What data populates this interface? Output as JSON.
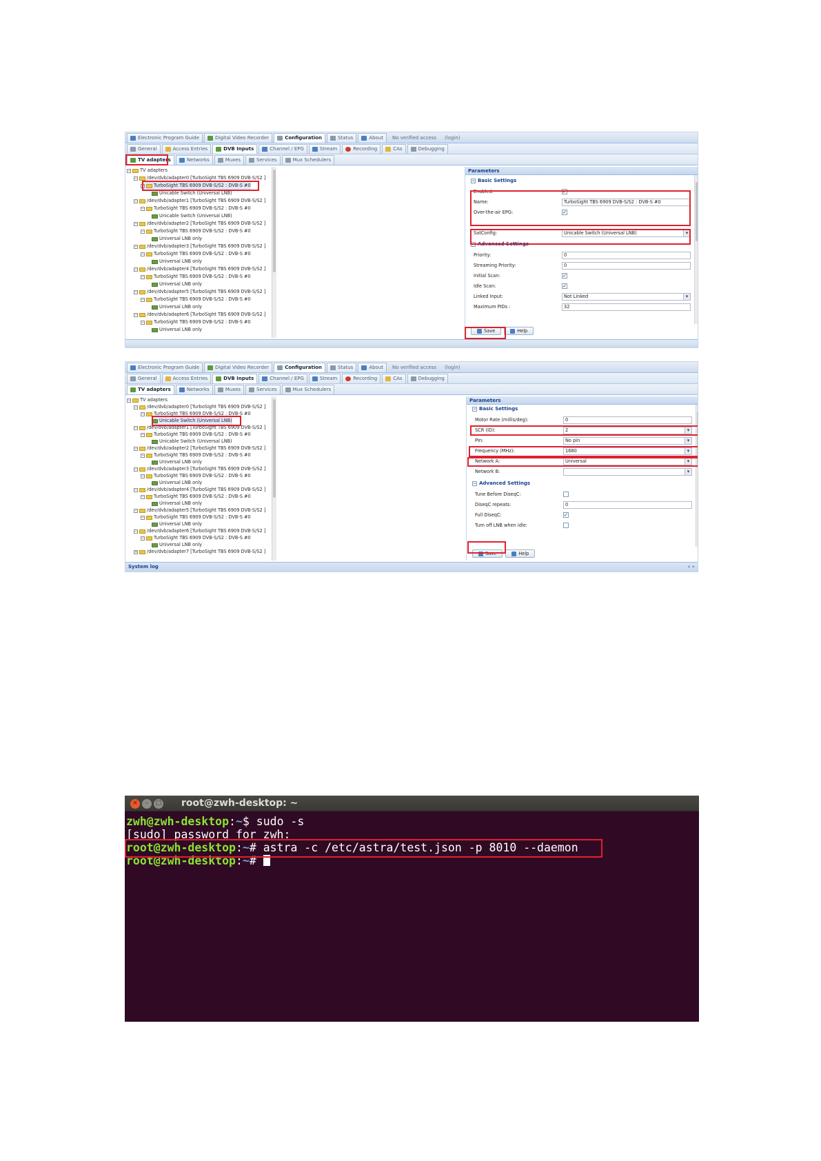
{
  "nav": {
    "top_tabs": [
      {
        "label": "Electronic Program Guide"
      },
      {
        "label": "Digital Video Recorder"
      },
      {
        "label": "Configuration"
      },
      {
        "label": "Status"
      },
      {
        "label": "About"
      }
    ],
    "access_text": "No verified access",
    "login_text": "(login)",
    "config_tabs": [
      {
        "label": "General"
      },
      {
        "label": "Access Entries"
      },
      {
        "label": "DVB Inputs"
      },
      {
        "label": "Channel / EPG"
      },
      {
        "label": "Stream"
      },
      {
        "label": "Recording"
      },
      {
        "label": "CAs"
      },
      {
        "label": "Debugging"
      }
    ],
    "dvb_tabs": [
      {
        "label": "TV adapters"
      },
      {
        "label": "Networks"
      },
      {
        "label": "Muxes"
      },
      {
        "label": "Services"
      },
      {
        "label": "Mux Schedulers"
      }
    ]
  },
  "tree": {
    "root": "TV adapters",
    "adapters": [
      {
        "label": "/dev/dvb/adapter0 [TurboSight TBS 6909 DVB-S/S2 ]",
        "frontend": "TurboSight TBS 6909 DVB-S/S2 : DVB-S #0",
        "lnb": "Unicable Switch (Universal LNB)"
      },
      {
        "label": "/dev/dvb/adapter1 [TurboSight TBS 6909 DVB-S/S2 ]",
        "frontend": "TurboSight TBS 6909 DVB-S/S2 : DVB-S #0",
        "lnb": "Unicable Switch (Universal LNB)"
      },
      {
        "label": "/dev/dvb/adapter2 [TurboSight TBS 6909 DVB-S/S2 ]",
        "frontend": "TurboSight TBS 6909 DVB-S/S2 : DVB-S #0",
        "lnb": "Universal LNB only"
      },
      {
        "label": "/dev/dvb/adapter3 [TurboSight TBS 6909 DVB-S/S2 ]",
        "frontend": "TurboSight TBS 6909 DVB-S/S2 : DVB-S #0",
        "lnb": "Universal LNB only"
      },
      {
        "label": "/dev/dvb/adapter4 [TurboSight TBS 6909 DVB-S/S2 ]",
        "frontend": "TurboSight TBS 6909 DVB-S/S2 : DVB-S #0",
        "lnb": "Universal LNB only"
      },
      {
        "label": "/dev/dvb/adapter5 [TurboSight TBS 6909 DVB-S/S2 ]",
        "frontend": "TurboSight TBS 6909 DVB-S/S2 : DVB-S #0",
        "lnb": "Universal LNB only"
      },
      {
        "label": "/dev/dvb/adapter6 [TurboSight TBS 6909 DVB-S/S2 ]",
        "frontend": "TurboSight TBS 6909 DVB-S/S2 : DVB-S #0",
        "lnb": "Universal LNB only"
      },
      {
        "label": "/dev/dvb/adapter7 [TurboSight TBS 6909 DVB-S/S2 ]"
      }
    ]
  },
  "params1": {
    "header": "Parameters",
    "basic_title": "Basic Settings",
    "advanced_title": "Advanced Settings",
    "rows": [
      {
        "label": "Enabled:",
        "value": "✓"
      },
      {
        "label": "Name:",
        "value": "TurboSight TBS 6909 DVB-S/S2 : DVB-S #0"
      },
      {
        "label": "Over-the-air EPG:",
        "value": "✓"
      },
      {
        "label": "SatConfig:",
        "value": "Unicable Switch (Universal LNB)"
      },
      {
        "label": "Priority:",
        "value": "0"
      },
      {
        "label": "Streaming Priority:",
        "value": "0"
      },
      {
        "label": "Initial Scan:",
        "value": "✓"
      },
      {
        "label": "Idle Scan:",
        "value": "✓"
      },
      {
        "label": "Linked Input:",
        "value": "Not Linked"
      },
      {
        "label": "Maximum PIDs :",
        "value": "32"
      }
    ]
  },
  "params2": {
    "header": "Parameters",
    "basic_title": "Basic Settings",
    "advanced_title": "Advanced Settings",
    "rows": [
      {
        "label": "Motor Rate (millis/deg):",
        "value": "0"
      },
      {
        "label": "SCR (ID):",
        "value": "2"
      },
      {
        "label": "PIn:",
        "value": "No pin"
      },
      {
        "label": "Frequency (MHz):",
        "value": "1680"
      },
      {
        "label": "Network A:",
        "value": "Universal"
      },
      {
        "label": "Network B:",
        "value": ""
      },
      {
        "label": "Tune Before DiseqC:",
        "value": ""
      },
      {
        "label": "DiseqC repeats:",
        "value": "0"
      },
      {
        "label": "Full DiseqC:",
        "value": "✓"
      },
      {
        "label": "Turn off LNB when idle:",
        "value": ""
      }
    ]
  },
  "buttons": {
    "save": "Save",
    "help": "Help"
  },
  "syslog": {
    "title": "System log",
    "ctl": "« »"
  },
  "terminal": {
    "title": "root@zwh-desktop: ~",
    "lines": [
      {
        "user": "zwh@zwh-desktop",
        "sep": ":",
        "path": "~",
        "sym": "$ ",
        "cmd": "sudo -s"
      },
      {
        "plain": "[sudo] password for zwh:"
      },
      {
        "user": "root@zwh-desktop",
        "sep": ":",
        "path": "~",
        "sym": "# ",
        "cmd": "astra -c /etc/astra/test.json -p 8010 --daemon"
      },
      {
        "user": "root@zwh-desktop",
        "sep": ":",
        "path": "~",
        "sym": "# ",
        "cmd": ""
      }
    ]
  },
  "colors": {
    "highlight": "#e0202d",
    "terminal_bg": "#300a24",
    "prompt_user": "#8ae234",
    "prompt_path": "#729fcf",
    "panel_header": "#15428b"
  }
}
